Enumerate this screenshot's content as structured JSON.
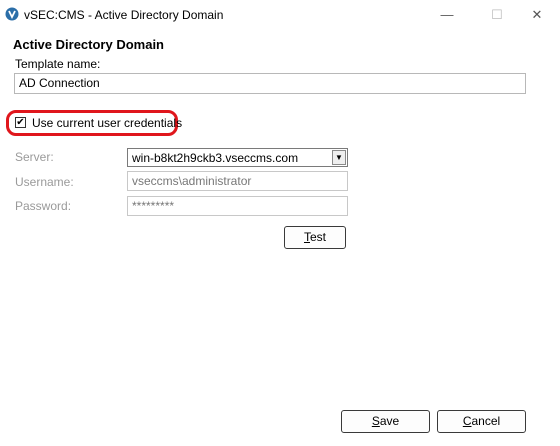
{
  "window": {
    "title": "vSEC:CMS - Active Directory Domain",
    "minimize_glyph": "—",
    "maximize_glyph": "☐",
    "close_glyph": "✕"
  },
  "form": {
    "heading": "Active Directory Domain",
    "template_label": "Template name:",
    "template_value": "AD Connection",
    "use_current_credentials_label": "Use current user credentials",
    "use_current_credentials_checked": true,
    "server_label": "Server:",
    "server_value": "win-b8kt2h9ckb3.vseccms.com",
    "username_label": "Username:",
    "username_value": "vseccms\\administrator",
    "password_label": "Password:",
    "password_value": "*********"
  },
  "buttons": {
    "test_mnemonic": "T",
    "test_rest": "est",
    "save_mnemonic": "S",
    "save_rest": "ave",
    "cancel_mnemonic": "C",
    "cancel_rest": "ancel"
  },
  "colors": {
    "highlight": "#e0161c",
    "disabled_text": "#9a9a9a"
  },
  "icons": {
    "app": "app-logo-icon",
    "dropdown": "chevron-down-icon",
    "checkbox": "checkmark-icon"
  }
}
